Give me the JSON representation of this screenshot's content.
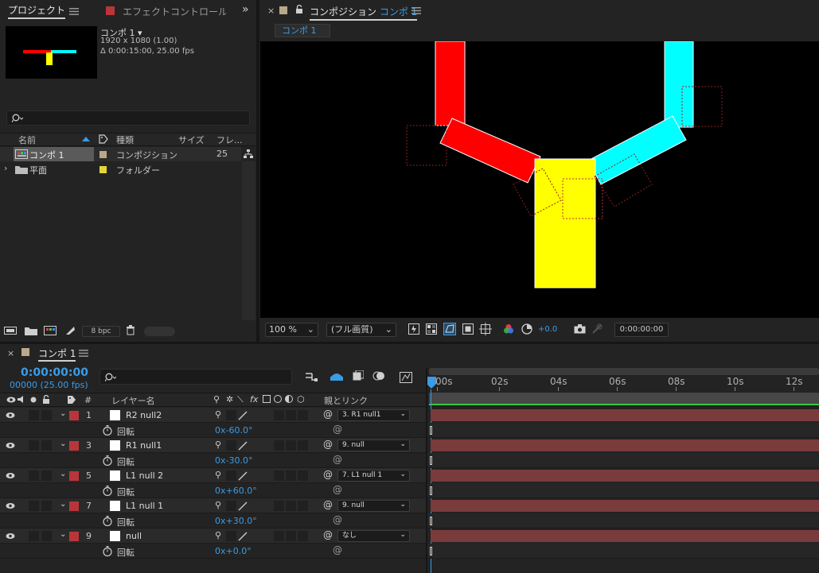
{
  "project_panel": {
    "tab_project": "プロジェクト",
    "tab_effect": "エフェクトコントロール R",
    "comp_name": "コンポ 1 ▾",
    "comp_res": "1920 x 1080 (1.00)",
    "comp_dur": "Δ 0:00:15:00, 25.00 fps",
    "col_name": "名前",
    "col_type": "種類",
    "col_size": "サイズ",
    "col_frame": "フレ...",
    "items": [
      {
        "name": "コンポ 1",
        "type": "コンポジション",
        "size": "25"
      },
      {
        "name": "平面",
        "type": "フォルダー",
        "size": ""
      }
    ],
    "bpc": "8 bpc"
  },
  "comp_panel": {
    "title": "コンポジション",
    "title_link": "コンポ 1",
    "sub_tab": "コンポ 1",
    "zoom": "100 %",
    "quality": "(フル画質)",
    "exposure": "+0.0",
    "timecode": "0:00:00:00"
  },
  "timeline": {
    "tab": "コンポ 1",
    "timecode": "0:00:00:00",
    "fps_line": "00000 (25.00 fps)",
    "col_layer_name": "レイヤー名",
    "col_parent": "親とリンク",
    "col_hash": "#",
    "col_fx": "fx",
    "ticks": [
      "00s",
      "02s",
      "04s",
      "06s",
      "08s",
      "10s",
      "12s"
    ],
    "prop_name": "回転",
    "layers": [
      {
        "num": "1",
        "name": "R2 null2",
        "parent": "3. R1 null1",
        "rotation": "0x-60.0°"
      },
      {
        "num": "3",
        "name": "R1 null1",
        "parent": "9. null",
        "rotation": "0x-30.0°"
      },
      {
        "num": "5",
        "name": "L1 null 2",
        "parent": "7. L1 null 1",
        "rotation": "0x+60.0°"
      },
      {
        "num": "7",
        "name": "L1 null 1",
        "parent": "9. null",
        "rotation": "0x+30.0°"
      },
      {
        "num": "9",
        "name": "null",
        "parent": "なし",
        "rotation": "0x+0.0°"
      }
    ]
  },
  "colors": {
    "accent": "#3b9ce5",
    "label_red": "#b8363a",
    "shape_red": "#ff0000",
    "shape_cyan": "#00ffff",
    "shape_yellow": "#ffff00",
    "bar": "#7a3b3d",
    "work_area": "#3fc53f"
  }
}
